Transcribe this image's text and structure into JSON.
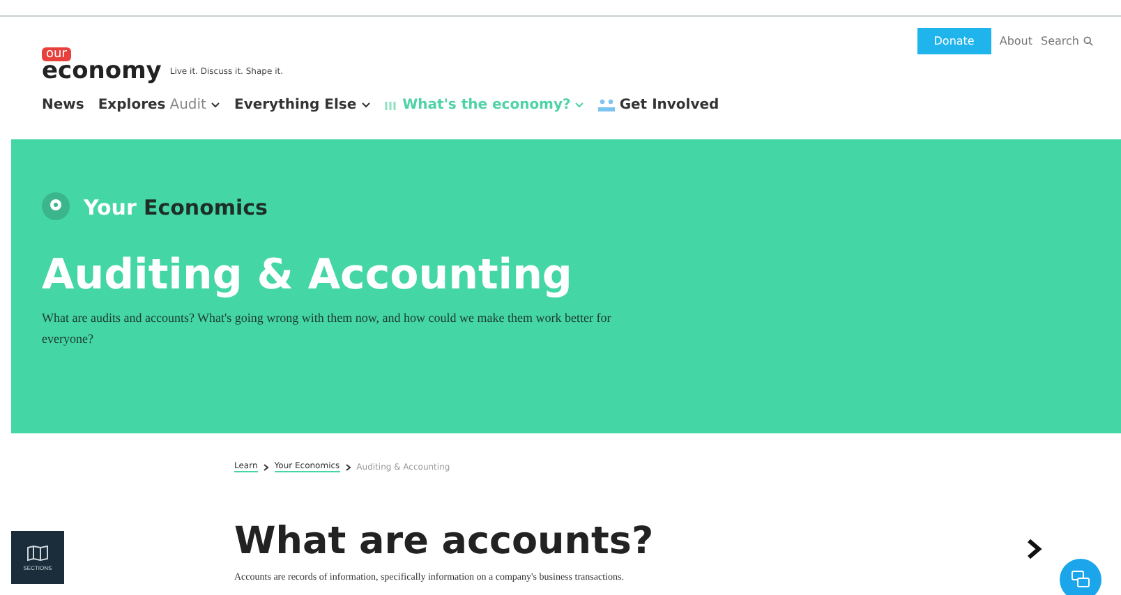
{
  "header": {
    "logo_badge": "our",
    "logo_word": "economy",
    "tagline": "Live it. Discuss it. Shape it.",
    "donate": "Donate",
    "links": [
      "About",
      "Search"
    ]
  },
  "nav": [
    {
      "label": "News",
      "kind": "plain"
    },
    {
      "label": "Explores",
      "sub": "Audit",
      "kind": "dropdown"
    },
    {
      "label": "Everything Else",
      "kind": "dropdown"
    },
    {
      "label": "What's the economy?",
      "kind": "highlight"
    },
    {
      "label": "Get Involved",
      "kind": "people"
    }
  ],
  "hero": {
    "section_light": "Your",
    "section_dark": "Economics",
    "title": "Auditing & Accounting",
    "intro": "What are audits and accounts? What's going wrong with them now, and how could we make them work better for everyone?"
  },
  "breadcrumb": [
    {
      "label": "Learn",
      "current": false
    },
    {
      "label": "Your Economics",
      "current": false
    },
    {
      "label": "Auditing & Accounting",
      "current": true
    }
  ],
  "sections_button": "SECTIONS",
  "article": {
    "heading": "What are accounts?",
    "text": "Accounts are records of information, specifically information on a company's business transactions."
  }
}
